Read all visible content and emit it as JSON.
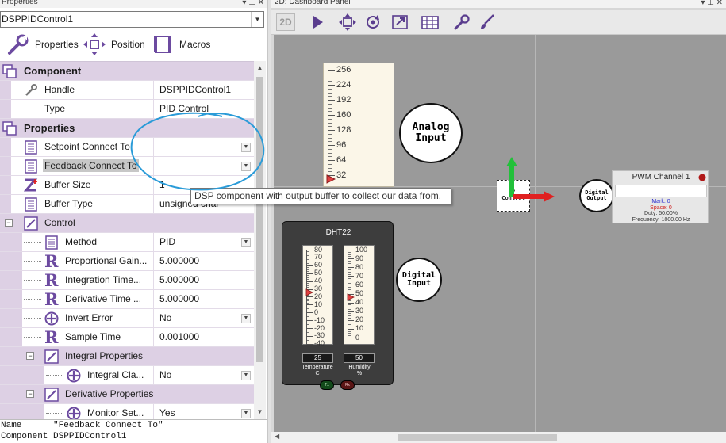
{
  "left_panel": {
    "title": "Properties",
    "title_icons": "▾ ⊥ ✕",
    "selected_component": "DSPPIDControl1",
    "tabs": [
      {
        "label": "Properties"
      },
      {
        "label": "Position"
      },
      {
        "label": "Macros"
      }
    ],
    "rows": {
      "component": {
        "label": "Component"
      },
      "handle": {
        "label": "Handle",
        "value": "DSPPIDControl1"
      },
      "type": {
        "label": "Type",
        "value": "PID Control"
      },
      "properties": {
        "label": "Properties"
      },
      "setpoint": {
        "label": "Setpoint Connect To",
        "value": ""
      },
      "feedback": {
        "label": "Feedback Connect To",
        "value": ""
      },
      "buffer_size": {
        "label": "Buffer Size",
        "value": "1"
      },
      "buffer_type": {
        "label": "Buffer Type",
        "value": "unsigned char"
      },
      "control": {
        "label": "Control"
      },
      "method": {
        "label": "Method",
        "value": "PID"
      },
      "proportional": {
        "label": "Proportional Gain...",
        "value": "5.000000"
      },
      "integration": {
        "label": "Integration Time...",
        "value": "5.000000"
      },
      "derivative": {
        "label": "Derivative Time ...",
        "value": "5.000000"
      },
      "invert": {
        "label": "Invert Error",
        "value": "No"
      },
      "sample": {
        "label": "Sample Time",
        "value": "0.001000"
      },
      "integral_props": {
        "label": "Integral Properties"
      },
      "integral_clamp": {
        "label": "Integral Cla...",
        "value": "No"
      },
      "derivative_props": {
        "label": "Derivative Properties"
      },
      "monitor": {
        "label": "Monitor Set...",
        "value": "Yes"
      }
    },
    "description": {
      "line1": "Name      \"Feedback Connect To\"",
      "line2": "Component DSPPIDControl1"
    }
  },
  "dashboard": {
    "title": "2D: Dashboard Panel",
    "title_icons": "▾ ⊥ ✕",
    "view_button": "2D",
    "analog_scale": [
      "256",
      "224",
      "192",
      "160",
      "128",
      "96",
      "64",
      "32"
    ],
    "analog_pointer_value": 32,
    "analog_bubble": [
      "Analog",
      "Input"
    ],
    "digital_input_bubble": [
      "Digital",
      "Input"
    ],
    "digital_output_bubble": [
      "Digital",
      "Output"
    ],
    "pid_block_label": [
      "P",
      "Control"
    ],
    "pwm": {
      "title": "PWM Channel 1",
      "line1": "Mark: 0",
      "line2": "Space: 0",
      "line3": "Duty: 50.00%",
      "line4": "Frequency: 1000.00 Hz"
    },
    "dht": {
      "title": "DHT22",
      "temp_scale": [
        "80",
        "70",
        "60",
        "50",
        "40",
        "30",
        "20",
        "10",
        "0",
        "-10",
        "-20",
        "-30",
        "-40"
      ],
      "humid_scale": [
        "100",
        "90",
        "80",
        "70",
        "60",
        "50",
        "40",
        "30",
        "20",
        "10",
        "0"
      ],
      "temp_value": "25",
      "temp_label": [
        "Temperature",
        "C"
      ],
      "humid_value": "50",
      "humid_label": [
        "Humidity",
        "%"
      ],
      "button_left": "Tx",
      "button_right": "Rx"
    },
    "tooltip": "DSP component with output buffer to collect our data from."
  },
  "colors": {
    "category_band": "#ddd0e4",
    "canvas": "#9a9a9a",
    "annotation_circle": "#2a9bd8",
    "arrow_green": "#22c03a",
    "arrow_red": "#e02020"
  }
}
